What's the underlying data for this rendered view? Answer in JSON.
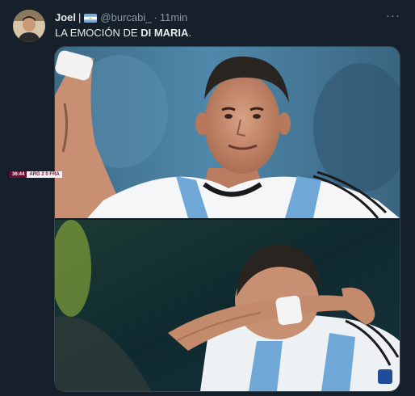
{
  "tweet": {
    "author_name": "Joel",
    "separator": "|",
    "handle": "@burcabi_",
    "dot": "·",
    "time": "11min",
    "text_normal": "LA EMOCIÓN DE ",
    "text_bold": "DI MARIA",
    "text_end": ".",
    "more_icon": "more-icon",
    "more_label": "···"
  },
  "scorebug": {
    "clock": "36:44",
    "home": "ARG",
    "home_score": "2",
    "away_score": "0",
    "away": "FRA"
  },
  "colors": {
    "background": "#15202b",
    "text_primary": "#e7e9ea",
    "text_secondary": "#8b98a5",
    "media_border": "#38444d"
  }
}
